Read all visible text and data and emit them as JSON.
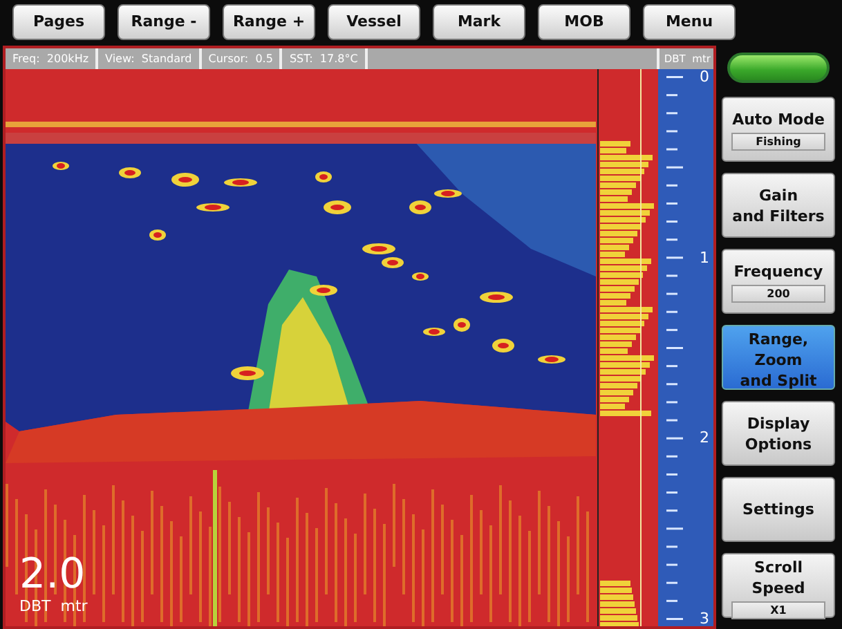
{
  "top_buttons": [
    {
      "label": "Pages"
    },
    {
      "label": "Range -"
    },
    {
      "label": "Range +"
    },
    {
      "label": "Vessel"
    },
    {
      "label": "Mark"
    },
    {
      "label": "MOB"
    },
    {
      "label": "Menu"
    }
  ],
  "status_bar": {
    "fields": [
      "Freq:  200kHz",
      "View:  Standard",
      "Cursor:  0.5",
      "SST:  17.8°C"
    ],
    "units": "DBT  mtr"
  },
  "depth_scale": {
    "labels": [
      "0",
      "1",
      "2",
      "3"
    ]
  },
  "depth_readout": {
    "value": "2.0",
    "label": "DBT  mtr"
  },
  "side_buttons": [
    {
      "label": "Auto Mode",
      "value": "Fishing",
      "selected": false
    },
    {
      "label": "Gain\nand Filters",
      "selected": false
    },
    {
      "label": "Frequency",
      "value": "200",
      "selected": false
    },
    {
      "label": "Range,\nZoom\nand Split",
      "selected": true
    },
    {
      "label": "Display\nOptions",
      "selected": false
    },
    {
      "label": "Settings",
      "selected": false
    },
    {
      "label": "Scroll\nSpeed",
      "value": "X1",
      "selected": false
    }
  ]
}
